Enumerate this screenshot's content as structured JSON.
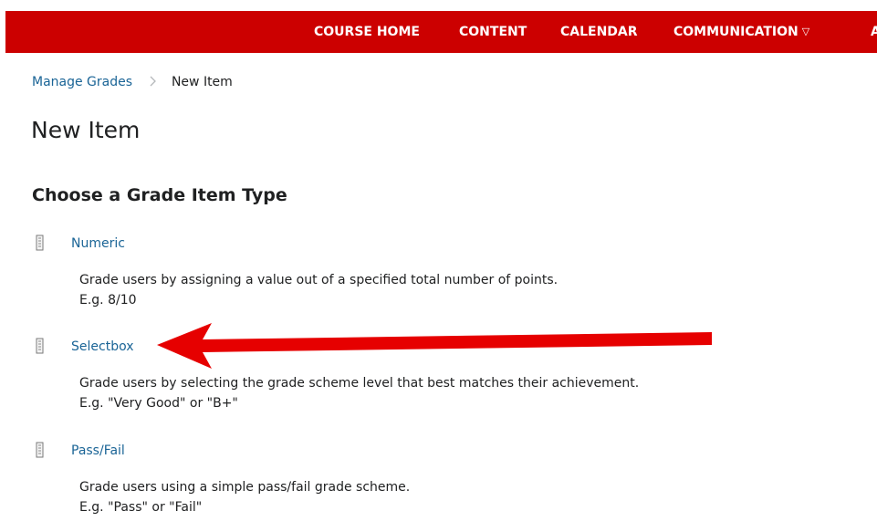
{
  "nav": {
    "course_home": "COURSE HOME",
    "content": "CONTENT",
    "calendar": "CALENDAR",
    "communication": "COMMUNICATION",
    "communication_caret": "▽",
    "more_partial": "A"
  },
  "breadcrumb": {
    "parent": "Manage Grades",
    "separator": ">",
    "current": "New Item"
  },
  "page_title": "New Item",
  "section_heading": "Choose a Grade Item Type",
  "types": [
    {
      "label": "Numeric",
      "desc_line1": "Grade users by assigning a value out of a specified total number of points.",
      "desc_line2": "E.g. 8/10"
    },
    {
      "label": "Selectbox",
      "desc_line1": "Grade users by selecting the grade scheme level that best matches their achievement.",
      "desc_line2": "E.g. \"Very Good\" or \"B+\""
    },
    {
      "label": "Pass/Fail",
      "desc_line1": "Grade users using a simple pass/fail grade scheme.",
      "desc_line2": "E.g. \"Pass\" or \"Fail\""
    }
  ],
  "colors": {
    "navbar": "#cc0000",
    "link": "#1a6496",
    "arrow": "#e60000"
  },
  "icons": {
    "grade_type": "grade-item-icon",
    "arrow": "annotation-arrow-icon"
  }
}
